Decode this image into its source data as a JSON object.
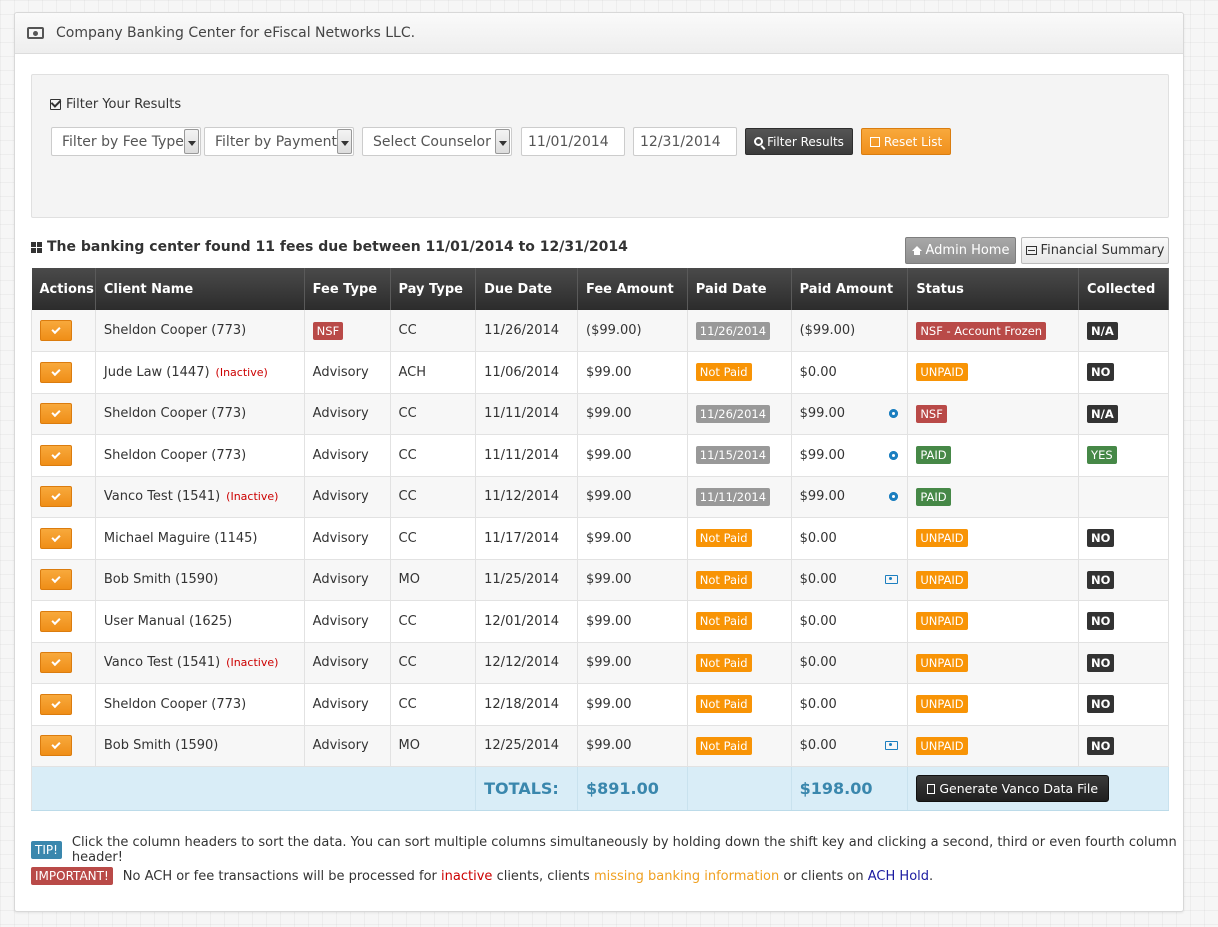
{
  "header": {
    "title": "Company Banking Center for eFiscal Networks LLC.",
    "icon": "money-icon"
  },
  "filters": {
    "title": "Filter Your Results",
    "fee_type": "Filter by Fee Type",
    "payment": "Filter by Payment",
    "counselor": "Select Counselor",
    "start_date": "11/01/2014",
    "end_date": "12/31/2014",
    "filter_button": "Filter Results",
    "reset_button": "Reset List"
  },
  "summary": {
    "text": "The banking center found 11 fees due between 11/01/2014 to 12/31/2014",
    "admin_home": "Admin Home",
    "financial_summary": "Financial Summary"
  },
  "table": {
    "columns": [
      "Actions",
      "Client Name",
      "Fee Type",
      "Pay Type",
      "Due Date",
      "Fee Amount",
      "Paid Date",
      "Paid Amount",
      "Status",
      "Collected"
    ],
    "rows": [
      {
        "client": "Sheldon Cooper (773)",
        "inactive": "",
        "fee_type": "NSF",
        "fee_badge": true,
        "pay_type": "CC",
        "due": "11/26/2014",
        "fee": "($99.00)",
        "paid_date": "11/26/2014",
        "paid_date_style": "gray",
        "paid_amount": "($99.00)",
        "icon": "",
        "status": "NSF - Account Frozen",
        "status_style": "red",
        "collected": "N/A",
        "collected_style": "black"
      },
      {
        "client": "Jude Law (1447)",
        "inactive": "(Inactive)",
        "fee_type": "Advisory",
        "fee_badge": false,
        "pay_type": "ACH",
        "due": "11/06/2014",
        "fee": "$99.00",
        "paid_date": "Not Paid",
        "paid_date_style": "orange",
        "paid_amount": "$0.00",
        "icon": "",
        "status": "UNPAID",
        "status_style": "orange",
        "collected": "NO",
        "collected_style": "black"
      },
      {
        "client": "Sheldon Cooper (773)",
        "inactive": "",
        "fee_type": "Advisory",
        "fee_badge": false,
        "pay_type": "CC",
        "due": "11/11/2014",
        "fee": "$99.00",
        "paid_date": "11/26/2014",
        "paid_date_style": "gray",
        "paid_amount": "$99.00",
        "icon": "gear-icon",
        "status": "NSF",
        "status_style": "red",
        "collected": "N/A",
        "collected_style": "black"
      },
      {
        "client": "Sheldon Cooper (773)",
        "inactive": "",
        "fee_type": "Advisory",
        "fee_badge": false,
        "pay_type": "CC",
        "due": "11/11/2014",
        "fee": "$99.00",
        "paid_date": "11/15/2014",
        "paid_date_style": "gray",
        "paid_amount": "$99.00",
        "icon": "gear-icon",
        "status": "PAID",
        "status_style": "green",
        "collected": "YES",
        "collected_style": "green"
      },
      {
        "client": "Vanco Test (1541)",
        "inactive": "(Inactive)",
        "fee_type": "Advisory",
        "fee_badge": false,
        "pay_type": "CC",
        "due": "11/12/2014",
        "fee": "$99.00",
        "paid_date": "11/11/2014",
        "paid_date_style": "gray",
        "paid_amount": "$99.00",
        "icon": "gear-icon",
        "status": "PAID",
        "status_style": "green",
        "collected": "",
        "collected_style": "none"
      },
      {
        "client": "Michael Maguire (1145)",
        "inactive": "",
        "fee_type": "Advisory",
        "fee_badge": false,
        "pay_type": "CC",
        "due": "11/17/2014",
        "fee": "$99.00",
        "paid_date": "Not Paid",
        "paid_date_style": "orange",
        "paid_amount": "$0.00",
        "icon": "",
        "status": "UNPAID",
        "status_style": "orange",
        "collected": "NO",
        "collected_style": "black"
      },
      {
        "client": "Bob Smith (1590)",
        "inactive": "",
        "fee_type": "Advisory",
        "fee_badge": false,
        "pay_type": "MO",
        "due": "11/25/2014",
        "fee": "$99.00",
        "paid_date": "Not Paid",
        "paid_date_style": "orange",
        "paid_amount": "$0.00",
        "icon": "cash-icon",
        "status": "UNPAID",
        "status_style": "orange",
        "collected": "NO",
        "collected_style": "black"
      },
      {
        "client": "User Manual (1625)",
        "inactive": "",
        "fee_type": "Advisory",
        "fee_badge": false,
        "pay_type": "CC",
        "due": "12/01/2014",
        "fee": "$99.00",
        "paid_date": "Not Paid",
        "paid_date_style": "orange",
        "paid_amount": "$0.00",
        "icon": "",
        "status": "UNPAID",
        "status_style": "orange",
        "collected": "NO",
        "collected_style": "black"
      },
      {
        "client": "Vanco Test (1541)",
        "inactive": "(Inactive)",
        "fee_type": "Advisory",
        "fee_badge": false,
        "pay_type": "CC",
        "due": "12/12/2014",
        "fee": "$99.00",
        "paid_date": "Not Paid",
        "paid_date_style": "orange",
        "paid_amount": "$0.00",
        "icon": "",
        "status": "UNPAID",
        "status_style": "orange",
        "collected": "NO",
        "collected_style": "black"
      },
      {
        "client": "Sheldon Cooper (773)",
        "inactive": "",
        "fee_type": "Advisory",
        "fee_badge": false,
        "pay_type": "CC",
        "due": "12/18/2014",
        "fee": "$99.00",
        "paid_date": "Not Paid",
        "paid_date_style": "orange",
        "paid_amount": "$0.00",
        "icon": "",
        "status": "UNPAID",
        "status_style": "orange",
        "collected": "NO",
        "collected_style": "black"
      },
      {
        "client": "Bob Smith (1590)",
        "inactive": "",
        "fee_type": "Advisory",
        "fee_badge": false,
        "pay_type": "MO",
        "due": "12/25/2014",
        "fee": "$99.00",
        "paid_date": "Not Paid",
        "paid_date_style": "orange",
        "paid_amount": "$0.00",
        "icon": "cash-icon",
        "status": "UNPAID",
        "status_style": "orange",
        "collected": "NO",
        "collected_style": "black"
      }
    ],
    "totals": {
      "label": "TOTALS:",
      "fee_total": "$891.00",
      "paid_total": "$198.00",
      "generate_button": "Generate Vanco Data File"
    }
  },
  "tips": {
    "tip_badge": "TIP!",
    "tip_text": "Click the column headers to sort the data. You can sort multiple columns simultaneously by holding down the shift key and clicking a second, third or even fourth column header!",
    "important_badge": "IMPORTANT!",
    "important_pre": "No ACH or fee transactions will be processed for",
    "inactive": "inactive",
    "mid1": "clients, clients",
    "missing": "missing banking information",
    "mid2": "or clients on",
    "ach_hold": "ACH Hold",
    "end": "."
  },
  "colors": {
    "orange": "#f89406",
    "red": "#b94a48",
    "green": "#468847",
    "blue": "#3a87ad",
    "dark": "#333333"
  }
}
